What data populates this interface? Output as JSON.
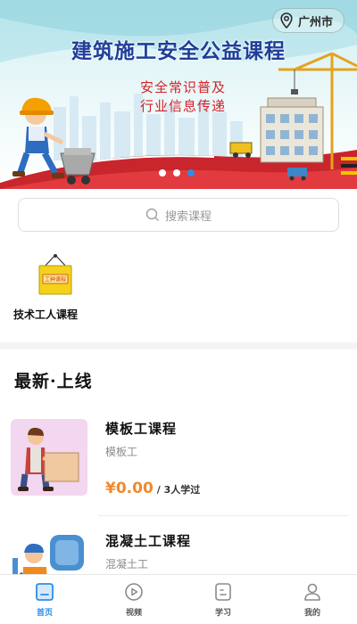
{
  "banner": {
    "title": "建筑施工安全公益课程",
    "subtitle_line1": "安全常识普及",
    "subtitle_line2": "行业信息传递",
    "location": "广州市",
    "location_icon": "location-pin-icon",
    "carousel_pages": 3,
    "carousel_active": 3,
    "colors": {
      "title": "#1f3f9a",
      "subtitle": "#d4232b",
      "active_dot": "#2e8de8"
    }
  },
  "search": {
    "placeholder": "搜索课程",
    "icon": "search-icon"
  },
  "categories": [
    {
      "label": "技术工人课程",
      "icon": "worker-sign-icon",
      "sign_text": "工种课程"
    }
  ],
  "section": {
    "title": "最新·上线"
  },
  "courses": [
    {
      "name": "模板工课程",
      "tag": "模板工",
      "price": "¥0.00",
      "learners": "/ 3人学过",
      "thumb_bg": "#f3d6ef"
    },
    {
      "name": "混凝土工课程",
      "tag": "混凝土工",
      "price": "",
      "learners": "",
      "thumb_bg": "#ffffff"
    }
  ],
  "tabbar": {
    "active": "home",
    "accent": "#2e8de8",
    "items": [
      {
        "key": "home",
        "label": "首页",
        "icon": "home-icon"
      },
      {
        "key": "video",
        "label": "视频",
        "icon": "play-icon"
      },
      {
        "key": "study",
        "label": "学习",
        "icon": "document-icon"
      },
      {
        "key": "mine",
        "label": "我的",
        "icon": "user-icon"
      }
    ]
  }
}
